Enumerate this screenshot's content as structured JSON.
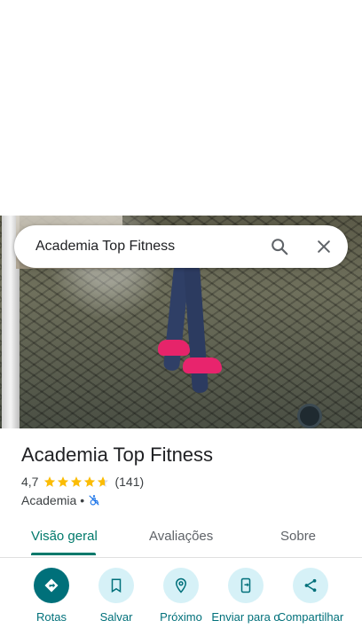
{
  "search": {
    "query": "Academia Top Fitness"
  },
  "place": {
    "name": "Academia Top Fitness",
    "rating": "4,7",
    "stars": 4.7,
    "review_count": "(141)",
    "category": "Academia",
    "separator": "•"
  },
  "tabs": [
    {
      "label": "Visão geral",
      "active": true
    },
    {
      "label": "Avaliações",
      "active": false
    },
    {
      "label": "Sobre",
      "active": false
    }
  ],
  "actions": [
    {
      "label": "Rotas",
      "icon": "directions-icon"
    },
    {
      "label": "Salvar",
      "icon": "bookmark-icon"
    },
    {
      "label": "Próximo",
      "icon": "nearby-icon"
    },
    {
      "label": "Enviar para o",
      "icon": "send-to-phone-icon"
    },
    {
      "label": "Compartilhar",
      "icon": "share-icon"
    }
  ],
  "colors": {
    "accent": "#00796b",
    "star": "#fbbc04",
    "chip_bg": "#d6f1f7"
  }
}
